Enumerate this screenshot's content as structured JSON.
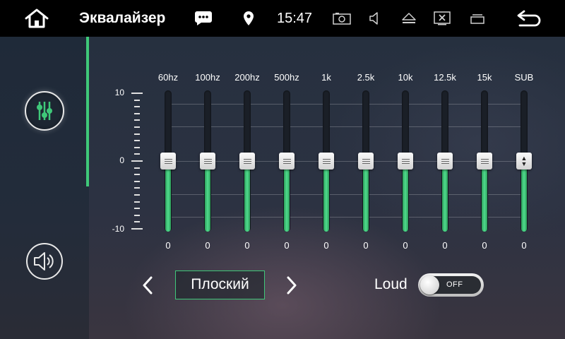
{
  "header": {
    "title": "Эквалайзер",
    "time": "15:47",
    "icons": [
      "home-icon",
      "message-icon",
      "location-pin-icon",
      "camera-icon",
      "volume-icon",
      "eject-icon",
      "close-screen-icon",
      "window-switch-icon",
      "back-icon"
    ]
  },
  "sidebar": {
    "items": [
      {
        "name": "equalizer",
        "icon": "equalizer-sliders-icon",
        "active": true
      },
      {
        "name": "sound-field",
        "icon": "speaker-icon",
        "active": false
      }
    ]
  },
  "equalizer": {
    "scale": {
      "max": "10",
      "mid": "0",
      "min": "-10"
    },
    "range": [
      -10,
      10
    ],
    "bands": [
      {
        "label": "60hz",
        "value": 0,
        "display": "0"
      },
      {
        "label": "100hz",
        "value": 0,
        "display": "0"
      },
      {
        "label": "200hz",
        "value": 0,
        "display": "0"
      },
      {
        "label": "500hz",
        "value": 0,
        "display": "0"
      },
      {
        "label": "1k",
        "value": 0,
        "display": "0"
      },
      {
        "label": "2.5k",
        "value": 0,
        "display": "0"
      },
      {
        "label": "10k",
        "value": 0,
        "display": "0"
      },
      {
        "label": "12.5k",
        "value": 0,
        "display": "0"
      },
      {
        "label": "15k",
        "value": 0,
        "display": "0"
      },
      {
        "label": "SUB",
        "value": 0,
        "display": "0"
      }
    ]
  },
  "preset": {
    "label": "Плоский"
  },
  "loud": {
    "label": "Loud",
    "state": "OFF"
  },
  "colors": {
    "accent": "#3fc879",
    "background": "#000000"
  }
}
